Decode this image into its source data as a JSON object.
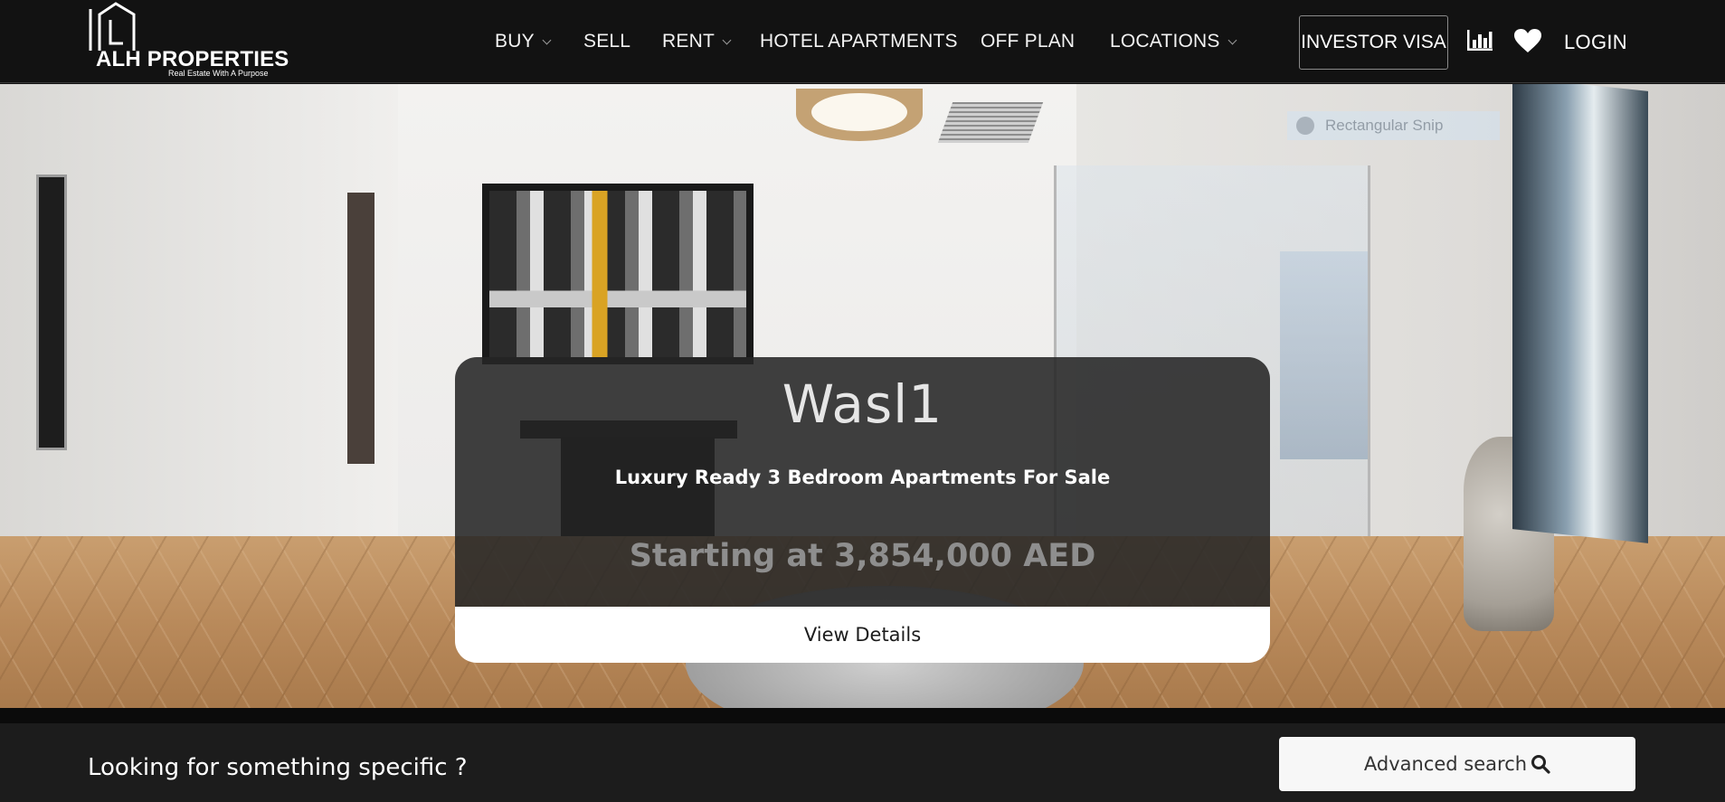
{
  "brand": {
    "name": "ALH PROPERTIES",
    "tagline": "Real Estate With A Purpose"
  },
  "nav": {
    "items": [
      {
        "label": "BUY",
        "has_dropdown": true
      },
      {
        "label": "SELL",
        "has_dropdown": false
      },
      {
        "label": "RENT",
        "has_dropdown": true
      },
      {
        "label": "HOTEL APARTMENTS",
        "has_dropdown": false
      },
      {
        "label": "OFF PLAN",
        "has_dropdown": false
      },
      {
        "label": "LOCATIONS",
        "has_dropdown": true
      }
    ],
    "investor_visa": "INVESTOR VISA",
    "stats_icon": "bar-chart-icon",
    "favorites_icon": "heart-icon",
    "login": "LOGIN"
  },
  "hero": {
    "overlay_ghost": "Rectangular Snip",
    "card": {
      "title": "Wasl1",
      "subtitle": "Luxury Ready 3 Bedroom Apartments For Sale",
      "price": "Starting at 3,854,000 AED",
      "button": "View Details"
    }
  },
  "search": {
    "heading": "Looking for something specific ?",
    "advanced_button": "Advanced search",
    "advanced_icon": "search-icon"
  },
  "colors": {
    "header_bg": "#121212",
    "card_bg": "#262626",
    "search_bar_bg": "#1c1c1c",
    "button_bg": "#ffffff"
  }
}
